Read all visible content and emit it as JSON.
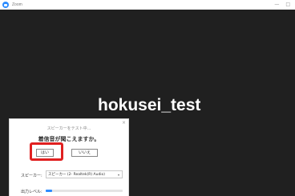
{
  "window": {
    "title": "Zoom",
    "controls": {
      "minimize": "—",
      "maximize": "□"
    }
  },
  "meeting": {
    "participant_name": "hokusei_test",
    "background_color": "#202020"
  },
  "speaker_test_dialog": {
    "status": "スピーカーをテスト中...",
    "question": "着信音が聞こえますか。",
    "yes_label": "はい",
    "no_label": "いいえ",
    "close_icon": "×",
    "speaker_label": "スピーカー:",
    "speaker_value": "スピーカー (2- Realtek(R) Audio)",
    "select_arrow": "▾",
    "output_level_label": "出力レベル:",
    "output_level": 0.08,
    "highlight_color": "#e02020",
    "accent_color": "#2d8cff"
  }
}
